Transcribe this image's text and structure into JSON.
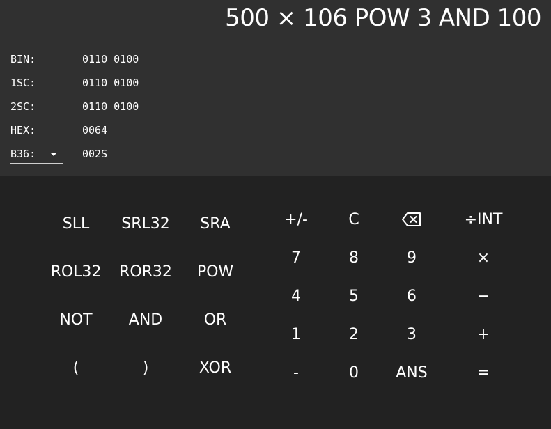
{
  "display": {
    "expression": "500 × 106 POW 3 AND 100"
  },
  "conversions": {
    "bin": {
      "label": "BIN:",
      "value": "0110 0100"
    },
    "ones_complement": {
      "label": "1SC:",
      "value": "0110 0100"
    },
    "twos_complement": {
      "label": "2SC:",
      "value": "0110 0100"
    },
    "hex": {
      "label": "HEX:",
      "value": "0064"
    },
    "base_select": {
      "label": "B36:",
      "value": "002S"
    }
  },
  "keypad": {
    "bitwise": {
      "sll": "SLL",
      "srl32": "SRL32",
      "sra": "SRA",
      "rol32": "ROL32",
      "ror32": "ROR32",
      "pow": "POW",
      "not": "NOT",
      "and": "AND",
      "or": "OR",
      "open_paren": "(",
      "close_paren": ")",
      "xor": "XOR"
    },
    "numeric": {
      "negate": "+/-",
      "clear": "C",
      "divide_int": "÷INT",
      "seven": "7",
      "eight": "8",
      "nine": "9",
      "multiply": "×",
      "four": "4",
      "five": "5",
      "six": "6",
      "minus": "−",
      "one": "1",
      "two": "2",
      "three": "3",
      "plus": "+",
      "dash": "-",
      "zero": "0",
      "ans": "ANS",
      "equals": "="
    },
    "icons": {
      "backspace": "backspace-icon"
    }
  },
  "colors": {
    "top_panel": "#303030",
    "keypad_bg": "#222222",
    "text": "#ffffff"
  }
}
